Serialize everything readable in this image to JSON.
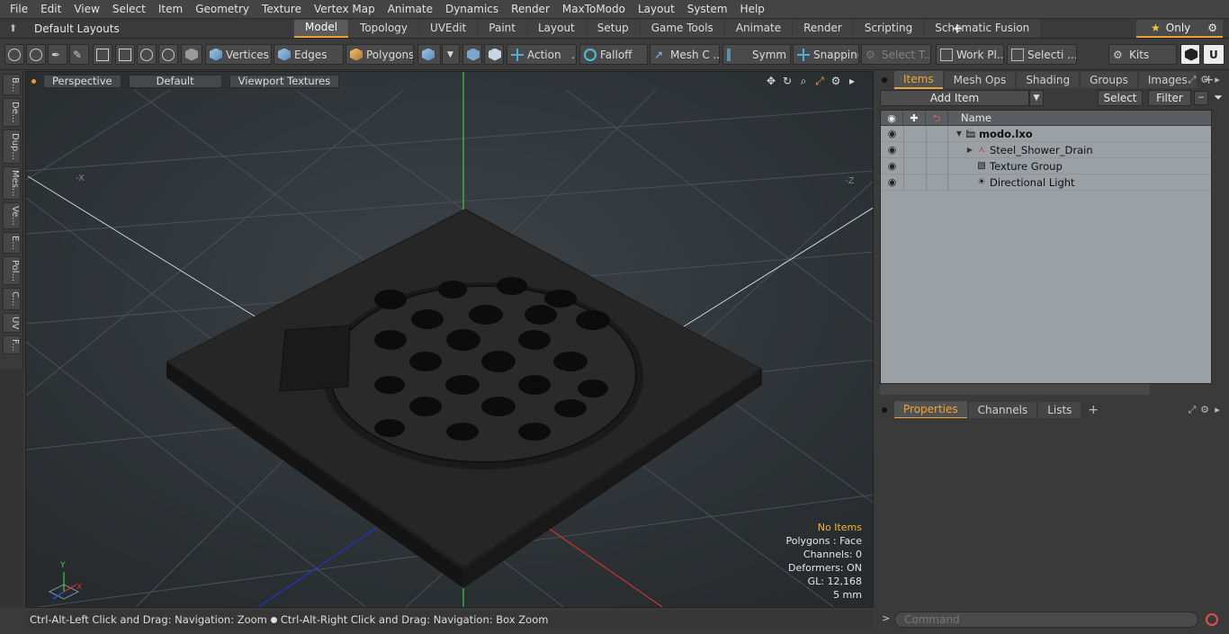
{
  "menubar": [
    "File",
    "Edit",
    "View",
    "Select",
    "Item",
    "Geometry",
    "Texture",
    "Vertex Map",
    "Animate",
    "Dynamics",
    "Render",
    "MaxToModo",
    "Layout",
    "System",
    "Help"
  ],
  "layouts": {
    "label": "Default Layouts"
  },
  "mode_tabs": [
    {
      "label": "Model",
      "active": true
    },
    {
      "label": "Topology"
    },
    {
      "label": "UVEdit"
    },
    {
      "label": "Paint"
    },
    {
      "label": "Layout"
    },
    {
      "label": "Setup"
    },
    {
      "label": "Game Tools"
    },
    {
      "label": "Animate"
    },
    {
      "label": "Render"
    },
    {
      "label": "Scripting"
    },
    {
      "label": "Schematic Fusion"
    }
  ],
  "only_label": "Only",
  "toolbar": {
    "vertices": "Vertices",
    "edges": "Edges",
    "polygons": "Polygons",
    "action": "Action",
    "action_more": "...",
    "falloff": "Falloff",
    "mesh": "Mesh C ...",
    "symm": "Symm ...",
    "snapping": "Snapping",
    "select_t": "Select T...",
    "work": "Work Pl...",
    "selecti": "Selecti ...",
    "kits": "Kits"
  },
  "left_tabs": [
    "B...",
    "De...",
    "Dup...",
    "Mes...",
    "Ve...",
    "E...",
    "Pol...",
    "C...",
    "UV",
    "F..."
  ],
  "viewport": {
    "view": "Perspective",
    "shading": "Default",
    "textures": "Viewport Textures",
    "info": {
      "selection": "No Items",
      "polygons": "Polygons : Face",
      "channels": "Channels: 0",
      "deformers": "Deformers: ON",
      "gl": "GL: 12,168",
      "unit": "5 mm"
    },
    "axis_labels": {
      "neg_x": "-X",
      "neg_z": "-Z"
    },
    "gizmo": {
      "y": "Y",
      "x": "X"
    }
  },
  "status": {
    "left": "Ctrl-Alt-Left Click and Drag: Navigation: Zoom",
    "right": "Ctrl-Alt-Right Click and Drag: Navigation: Box Zoom"
  },
  "right_tabs": [
    {
      "label": "Items",
      "active": true
    },
    {
      "label": "Mesh Ops"
    },
    {
      "label": "Shading"
    },
    {
      "label": "Groups"
    },
    {
      "label": "Images"
    }
  ],
  "items_toolbar": {
    "add": "Add Item",
    "select": "Select",
    "filter": "Filter"
  },
  "item_list": {
    "header_name": "Name",
    "rows": [
      {
        "label": "modo.lxo",
        "bold": true,
        "indent": 0,
        "icon": "scene-icon"
      },
      {
        "label": "Steel_Shower_Drain",
        "indent": 1,
        "icon": "mesh-icon"
      },
      {
        "label": "Texture Group",
        "indent": 1,
        "icon": "texture-icon"
      },
      {
        "label": "Directional Light",
        "indent": 1,
        "icon": "light-icon"
      }
    ]
  },
  "bottom_tabs": [
    {
      "label": "Properties",
      "active": true
    },
    {
      "label": "Channels"
    },
    {
      "label": "Lists"
    }
  ],
  "command": {
    "placeholder": "Command"
  },
  "colors": {
    "accent": "#e8a33c",
    "axis_y": "#3dcc3d",
    "axis_x": "#cc3333",
    "axis_z": "#2233cc"
  }
}
